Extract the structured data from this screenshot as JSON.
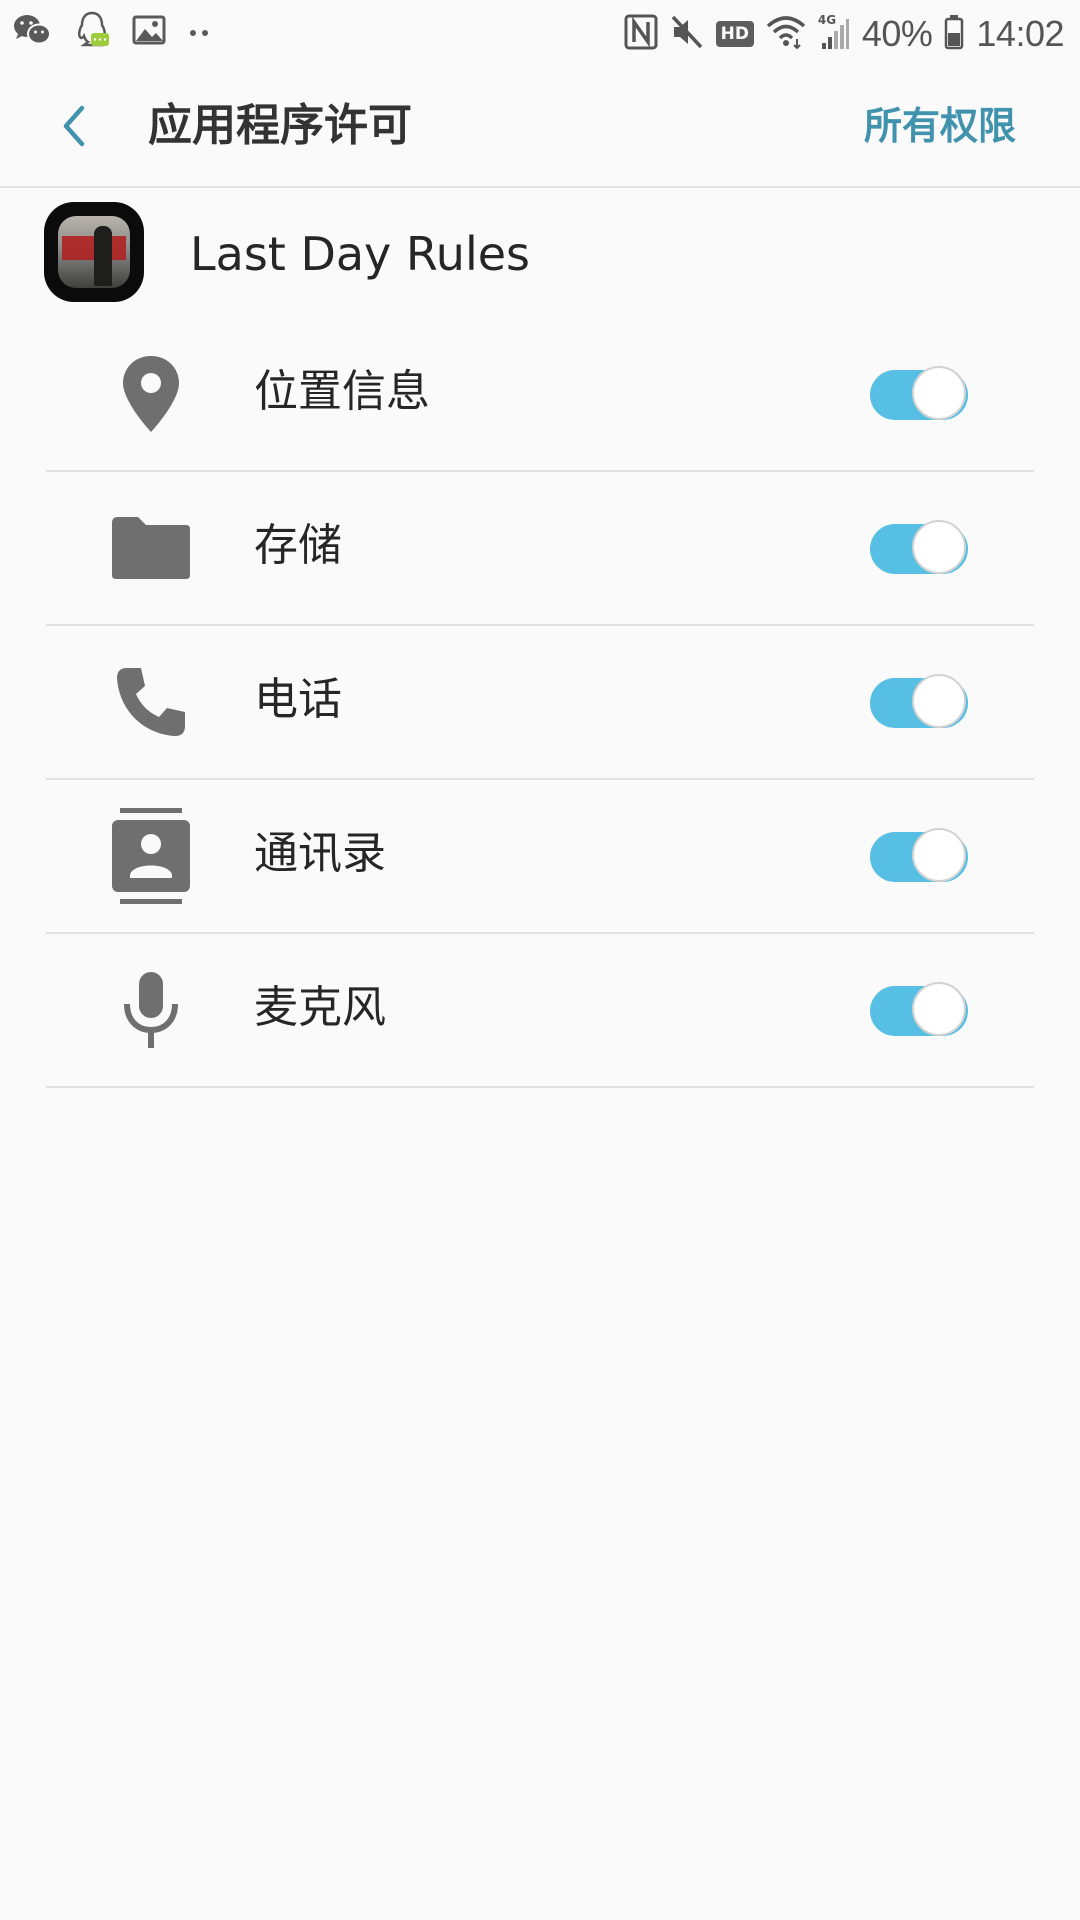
{
  "status_bar": {
    "battery_percent": "40%",
    "time": "14:02",
    "hd_badge": "HD",
    "network_type": "4G",
    "left_icons": [
      "wechat-icon",
      "qq-icon",
      "gallery-icon",
      "more-notifications-icon"
    ],
    "right_icons": [
      "nfc-icon",
      "mute-icon",
      "hd-icon",
      "wifi-icon",
      "signal-icon",
      "battery-icon"
    ]
  },
  "app_bar": {
    "title": "应用程序许可",
    "action_label": "所有权限",
    "back_icon": "chevron-left-icon"
  },
  "app": {
    "name": "Last Day Rules"
  },
  "permissions": [
    {
      "label": "位置信息",
      "icon": "location-pin-icon",
      "enabled": true
    },
    {
      "label": "存储",
      "icon": "folder-icon",
      "enabled": true
    },
    {
      "label": "电话",
      "icon": "phone-icon",
      "enabled": true
    },
    {
      "label": "通讯录",
      "icon": "contacts-icon",
      "enabled": true
    },
    {
      "label": "麦克风",
      "icon": "microphone-icon",
      "enabled": true
    }
  ],
  "colors": {
    "accent": "#4193ad",
    "toggle_on": "#56bfe3",
    "background": "#fafafa",
    "icon_gray": "#6f6f6f"
  }
}
